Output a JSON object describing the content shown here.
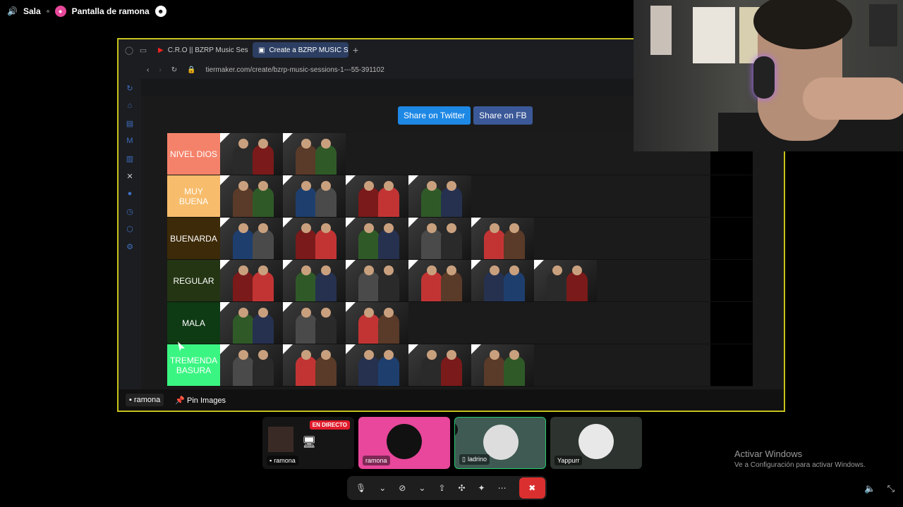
{
  "topbar": {
    "speaker_icon": "volume-icon",
    "channel": "Sala",
    "screen_owner": "Pantalla de ramona"
  },
  "browser": {
    "tabs": [
      {
        "label": "C.R.O || BZRP Music Sessi",
        "icon": "youtube-icon"
      },
      {
        "label": "Create a BZRP MUSIC SES",
        "icon": "tiermaker-icon"
      }
    ],
    "new_tab": "+",
    "url": "tiermaker.com/create/bzrp-music-sessions-1---55-391102"
  },
  "share": {
    "twitter": "Share on Twitter",
    "fb": "Share on FB"
  },
  "tiers": [
    {
      "label": "NIVEL DIOS",
      "color": "#f4826a",
      "count": 2
    },
    {
      "label": "MUY BUENA",
      "color": "#f7bd6c",
      "count": 4
    },
    {
      "label": "BUENARDA",
      "color": "#3d2a08",
      "count": 5
    },
    {
      "label": "REGULAR",
      "color": "#233512",
      "count": 6
    },
    {
      "label": "MALA",
      "color": "#0e3a14",
      "count": 3
    },
    {
      "label": "TREMENDA BASURA",
      "color": "#3bf582",
      "count": 5
    }
  ],
  "stream_footer": {
    "viewer": "ramona",
    "pin": "Pin Images"
  },
  "participants": [
    {
      "name": "ramona",
      "badge": "EN DIRECTO",
      "kind": "screen"
    },
    {
      "name": "ramona",
      "kind": "camera"
    },
    {
      "name": "ladrino",
      "kind": "phone"
    },
    {
      "name": "Yappurr",
      "kind": "avatar"
    }
  ],
  "controls": {
    "mic": "microphone-icon",
    "camera": "camera-off-icon",
    "share": "screen-share-icon",
    "activity": "activities-icon",
    "soundboard": "soundboard-icon",
    "more": "more-icon",
    "hangup": "leave-call-icon"
  },
  "watermark": {
    "line1": "Activar Windows",
    "line2": "Ve a Configuración para activar Windows."
  }
}
